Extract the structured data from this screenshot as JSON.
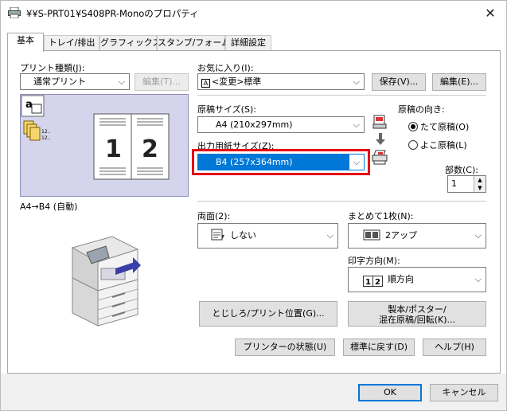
{
  "window": {
    "title": "¥¥S-PRT01¥S408PR-Monoのプロパティ",
    "close_glyph": "✕"
  },
  "tabs": [
    {
      "label": "基本",
      "active": true
    },
    {
      "label": "トレイ/排出"
    },
    {
      "label": "グラフィックス"
    },
    {
      "label": "スタンプ/フォーム"
    },
    {
      "label": "詳細設定"
    }
  ],
  "print_type": {
    "label": "プリント種類(J):",
    "value": "通常プリント",
    "edit_button": "編集(T)..."
  },
  "favorites": {
    "label": "お気に入り(I):",
    "value": "<変更>標準",
    "save_button": "保存(V)...",
    "edit_button": "編集(E)..."
  },
  "preview": {
    "page_numbers": [
      "1",
      "2"
    ],
    "caption": "A4→B4 (自動)",
    "icon_text": [
      "12..",
      "12.."
    ]
  },
  "original_size": {
    "label": "原稿サイズ(S):",
    "value": "A4 (210x297mm)"
  },
  "output_size": {
    "label": "出力用紙サイズ(Z):",
    "value": "B4 (257x364mm)"
  },
  "orientation": {
    "label": "原稿の向き:",
    "portrait": "たて原稿(O)",
    "landscape": "よこ原稿(L)",
    "selected": "portrait"
  },
  "copies": {
    "label": "部数(C):",
    "value": "1"
  },
  "duplex": {
    "label": "両面(2):",
    "value": "しない"
  },
  "nup": {
    "label": "まとめて1枚(N):",
    "value": "2アップ",
    "icon_text": "2"
  },
  "print_order": {
    "label": "印字方向(M):",
    "value": "順方向",
    "icon_text": [
      "1",
      "2"
    ]
  },
  "buttons": {
    "binding": "とじしろ/プリント位置(G)...",
    "booklet_line1": "製本/ポスター/",
    "booklet_line2": "混在原稿/回転(K)...",
    "printer_status": "プリンターの状態(U)",
    "defaults": "標準に戻す(D)",
    "help": "ヘルプ(H)",
    "ok": "OK",
    "cancel": "キャンセル"
  },
  "colors": {
    "accent": "#0078d7",
    "highlight_box": "#e60012",
    "preview_bg": "#d4d4ec"
  }
}
